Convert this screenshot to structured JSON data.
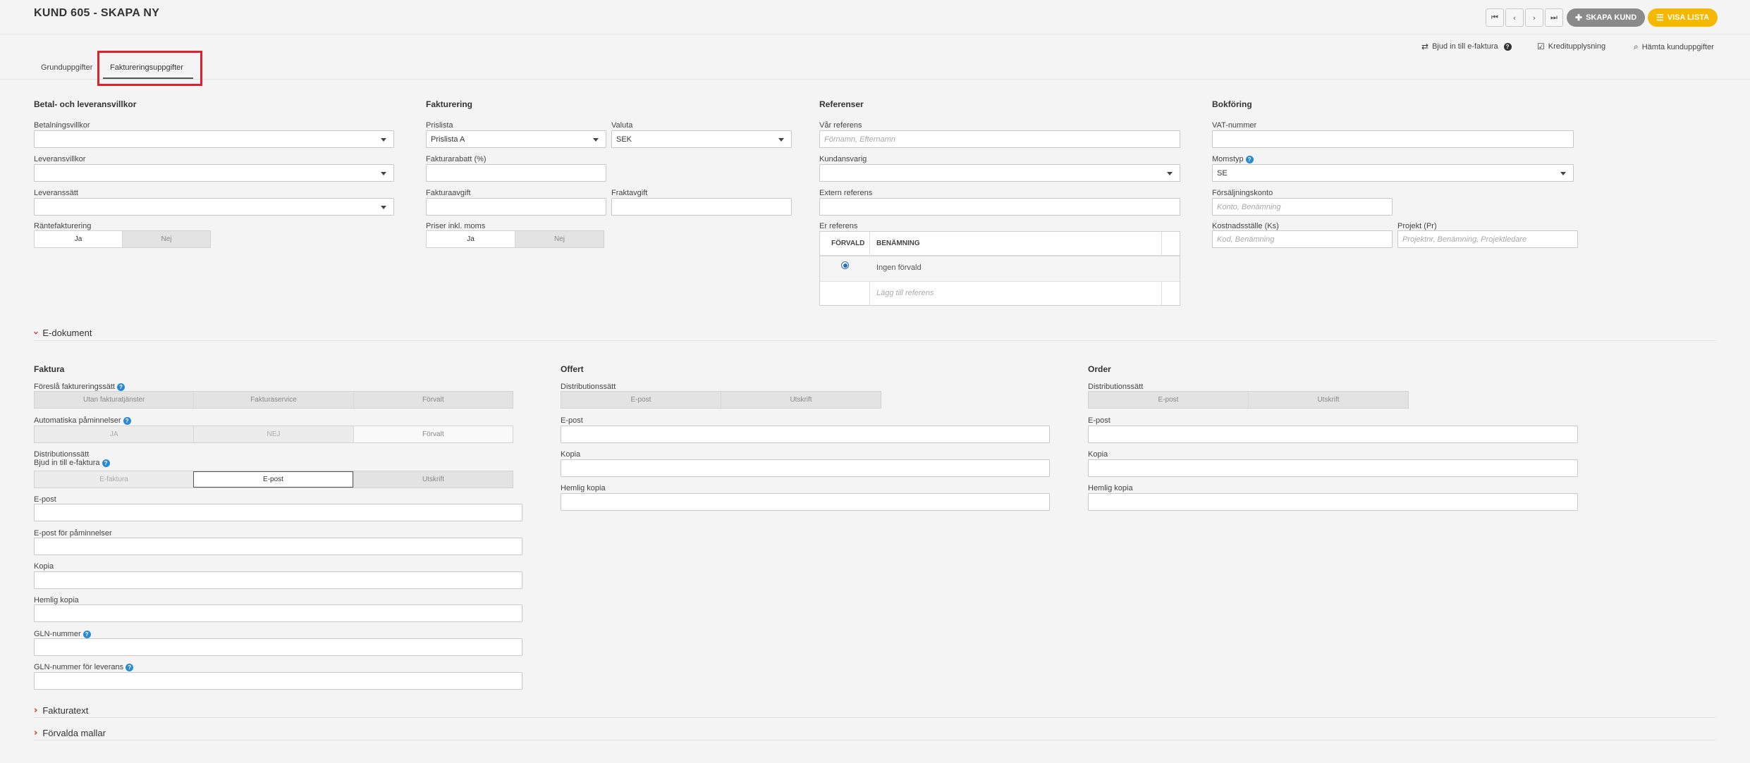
{
  "header": {
    "title": "KUND 605 - SKAPA NY",
    "nav": {
      "first": "⏮",
      "prev": "‹",
      "next": "›",
      "last": "⏭"
    },
    "create_button": "SKAPA KUND",
    "list_button": "VISA LISTA",
    "colors": {
      "create": "#8a8a8a",
      "list": "#f5b800"
    }
  },
  "toplinks": {
    "invite": "Bjud in till e-faktura",
    "credit": "Kreditupplysning",
    "fetch": "Hämta kunduppgifter"
  },
  "tabs": [
    {
      "label": "Grunduppgifter"
    },
    {
      "label": "Faktureringsuppgifter",
      "active": true
    }
  ],
  "terms": {
    "title": "Betal- och leveransvillkor",
    "payment_terms": "Betalningsvillkor",
    "delivery_terms": "Leveransvillkor",
    "delivery_method": "Leveranssätt",
    "interest": "Räntefakturering",
    "yes": "Ja",
    "no": "Nej"
  },
  "billing": {
    "title": "Fakturering",
    "pricelist_label": "Prislista",
    "pricelist_value": "Prislista A",
    "currency_label": "Valuta",
    "currency_value": "SEK",
    "discount": "Fakturarabatt (%)",
    "invoice_fee": "Fakturaavgift",
    "freight_fee": "Fraktavgift",
    "incl_vat": "Priser inkl. moms",
    "yes": "Ja",
    "no": "Nej"
  },
  "references": {
    "title": "Referenser",
    "our_ref": "Vår referens",
    "our_ref_ph": "Förnamn, Efternamn",
    "responsible": "Kundansvarig",
    "external_ref": "Extern referens",
    "your_ref": "Er referens",
    "col_default": "FÖRVALD",
    "col_name": "BENÄMNING",
    "row_none": "Ingen förvald",
    "add_ref": "Lägg till referens"
  },
  "accounting": {
    "title": "Bokföring",
    "vat_no": "VAT-nummer",
    "vat_type": "Momstyp",
    "vat_type_value": "SE",
    "sales_account": "Försäljningskonto",
    "sales_account_ph": "Konto, Benämning",
    "cost_center": "Kostnadsställe (Ks)",
    "cost_center_ph": "Kod, Benämning",
    "project": "Projekt (Pr)",
    "project_ph": "Projektnr, Benämning, Projektledare"
  },
  "edoc": {
    "title": "E-dokument",
    "invoice": {
      "title": "Faktura",
      "suggest": "Föreslå faktureringssätt",
      "suggest_opts": [
        "Utan fakturatjänster",
        "Fakturaservice",
        "Förvalt"
      ],
      "reminders": "Automatiska påminnelser",
      "reminder_opts": [
        "JA",
        "NEJ",
        "Förvalt"
      ],
      "distribution": "Distributionssätt",
      "invite": "Bjud in till e-faktura",
      "dist_opts": [
        "E-faktura",
        "E-post",
        "Utskrift"
      ],
      "email": "E-post",
      "email_reminders": "E-post för påminnelser",
      "copy": "Kopia",
      "bcc": "Hemlig kopia",
      "gln": "GLN-nummer",
      "gln_delivery": "GLN-nummer för leverans"
    },
    "offer": {
      "title": "Offert",
      "distribution": "Distributionssätt",
      "dist_opts": [
        "E-post",
        "Utskrift"
      ],
      "email": "E-post",
      "copy": "Kopia",
      "bcc": "Hemlig kopia"
    },
    "order": {
      "title": "Order",
      "distribution": "Distributionssätt",
      "dist_opts": [
        "E-post",
        "Utskrift"
      ],
      "email": "E-post",
      "copy": "Kopia",
      "bcc": "Hemlig kopia"
    }
  },
  "collapsed": {
    "invoice_text": "Fakturatext",
    "templates": "Förvalda mallar"
  }
}
